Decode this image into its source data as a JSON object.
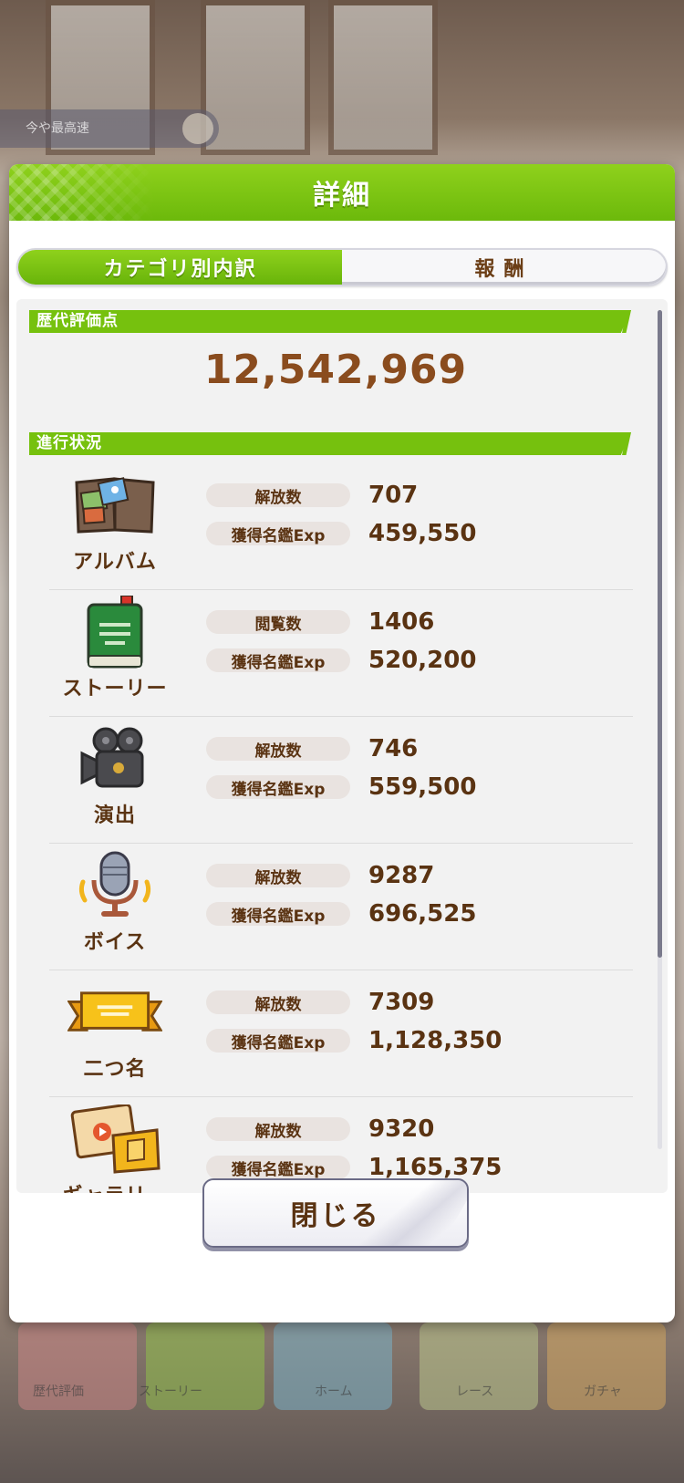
{
  "background": {
    "pill_text": "今や最高速",
    "bottom_tabs": [
      "歴代評価",
      "ストーリー",
      "ホーム",
      "レース",
      "ガチャ"
    ]
  },
  "dialog": {
    "title": "詳細",
    "tabs": [
      {
        "label": "カテゴリ別内訳",
        "active": true
      },
      {
        "label": "報酬",
        "active": false
      }
    ],
    "score_section": {
      "heading": "歴代評価点",
      "value": "12,542,969"
    },
    "progress_section": {
      "heading": "進行状況",
      "rows": [
        {
          "name": "アルバム",
          "icon": "album-icon",
          "stat1_label": "解放数",
          "stat1_value": "707",
          "stat2_label": "獲得名鑑Exp",
          "stat2_value": "459,550"
        },
        {
          "name": "ストーリー",
          "icon": "story-book-icon",
          "stat1_label": "閲覧数",
          "stat1_value": "1406",
          "stat2_label": "獲得名鑑Exp",
          "stat2_value": "520,200"
        },
        {
          "name": "演出",
          "icon": "movie-camera-icon",
          "stat1_label": "解放数",
          "stat1_value": "746",
          "stat2_label": "獲得名鑑Exp",
          "stat2_value": "559,500"
        },
        {
          "name": "ボイス",
          "icon": "microphone-icon",
          "stat1_label": "解放数",
          "stat1_value": "9287",
          "stat2_label": "獲得名鑑Exp",
          "stat2_value": "696,525"
        },
        {
          "name": "二つ名",
          "icon": "ribbon-banner-icon",
          "stat1_label": "解放数",
          "stat1_value": "7309",
          "stat2_label": "獲得名鑑Exp",
          "stat2_value": "1,128,350"
        },
        {
          "name": "ギャラリー",
          "icon": "gallery-icon",
          "stat1_label": "解放数",
          "stat1_value": "9320",
          "stat2_label": "獲得名鑑Exp",
          "stat2_value": "1,165,375"
        }
      ]
    },
    "close_label": "閉じる"
  },
  "colors": {
    "accent_green": "#76c10e",
    "text_brown": "#5a3312",
    "score_brown": "#8a4c1e"
  }
}
